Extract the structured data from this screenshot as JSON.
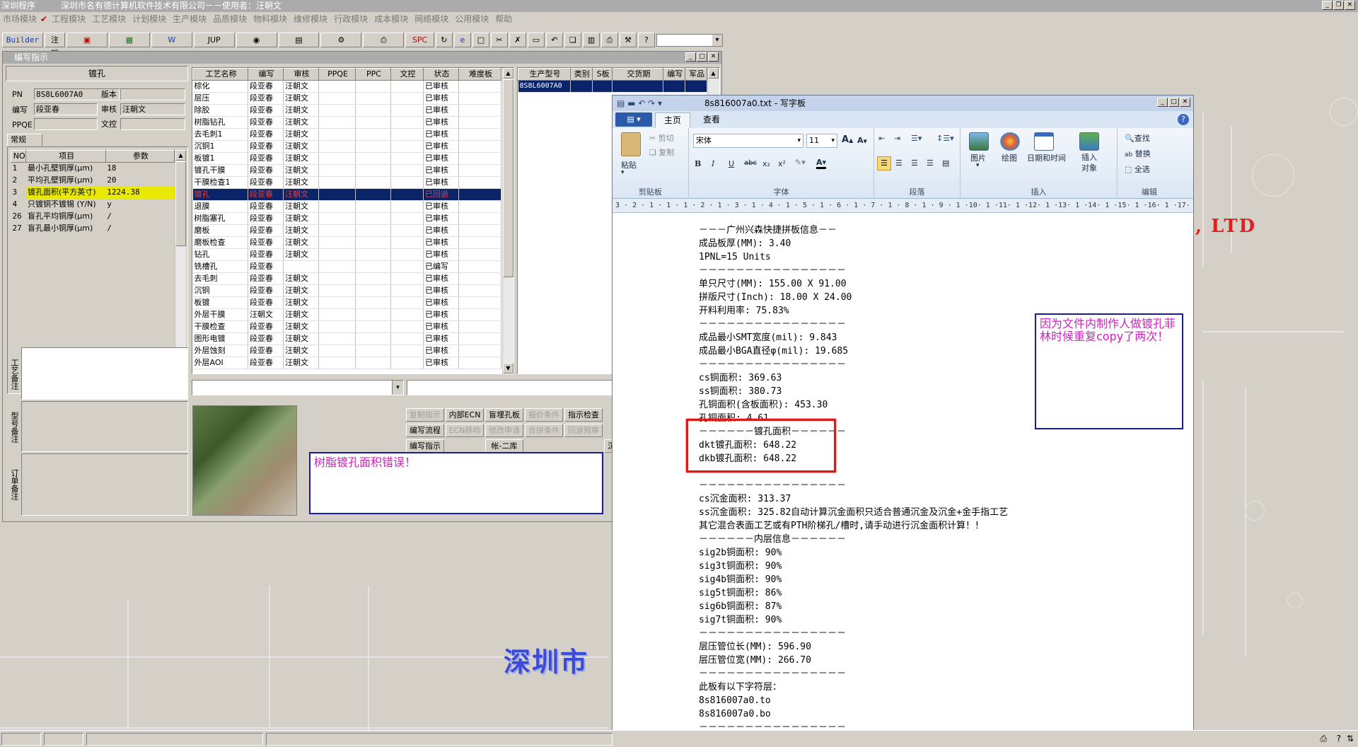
{
  "app": {
    "title": "深圳程序",
    "company": "深圳市名有德计算机软件技术有限公司－－使用者：汪朝文"
  },
  "menu": [
    "市场模块",
    "工程模块",
    "工艺模块",
    "计划模块",
    "生产模块",
    "品质模块",
    "物料模块",
    "维修模块",
    "行政模块",
    "成本模块",
    "网络模块",
    "公用模块",
    "帮助"
  ],
  "toolbar": {
    "builder": "Builder",
    "logout": "注销",
    "jup": "JUP",
    "spc": "SPC"
  },
  "editwin": {
    "title": "编写指示",
    "section": "镀孔",
    "pn_label": "PN",
    "pn_value": "8S8L6007A0",
    "version_label": "版本",
    "writer_label": "编写",
    "writer_value": "段亚春",
    "reviewer_label": "审核",
    "reviewer_value": "汪朝文",
    "ppqe_label": "PPQE",
    "doc_label": "文控",
    "tab_general": "常规",
    "param_headers": [
      "NO",
      "项目",
      "参数"
    ],
    "params": [
      {
        "no": "1",
        "item": "最小孔壁铜厚(μm)",
        "value": "18"
      },
      {
        "no": "2",
        "item": "平均孔壁铜厚(μm)",
        "value": "20"
      },
      {
        "no": "3",
        "item": "镀孔面积(平方英寸)",
        "value": "1224.38"
      },
      {
        "no": "4",
        "item": "只镀铜不镀锡 (Y/N)",
        "value": "y"
      },
      {
        "no": "26",
        "item": "盲孔平均铜厚(μm)",
        "value": "/"
      },
      {
        "no": "27",
        "item": "盲孔最小铜厚(μm)",
        "value": "/"
      }
    ],
    "side_labels": [
      "工艺备注",
      "型号备注",
      "订单备注"
    ],
    "process_headers": [
      "工艺名称",
      "编写",
      "审核",
      "PPQE",
      "PPC",
      "文控",
      "状态",
      "难度板"
    ],
    "processes": [
      [
        "棕化",
        "段亚春",
        "汪朝文",
        "",
        "",
        "",
        "已审核",
        ""
      ],
      [
        "层压",
        "段亚春",
        "汪朝文",
        "",
        "",
        "",
        "已审核",
        ""
      ],
      [
        "除胶",
        "段亚春",
        "汪朝文",
        "",
        "",
        "",
        "已审核",
        ""
      ],
      [
        "树脂钻孔",
        "段亚春",
        "汪朝文",
        "",
        "",
        "",
        "已审核",
        ""
      ],
      [
        "去毛刺1",
        "段亚春",
        "汪朝文",
        "",
        "",
        "",
        "已审核",
        ""
      ],
      [
        "沉铜1",
        "段亚春",
        "汪朝文",
        "",
        "",
        "",
        "已审核",
        ""
      ],
      [
        "板镀1",
        "段亚春",
        "汪朝文",
        "",
        "",
        "",
        "已审核",
        ""
      ],
      [
        "镀孔干膜",
        "段亚春",
        "汪朝文",
        "",
        "",
        "",
        "已审核",
        ""
      ],
      [
        "干膜检查1",
        "段亚春",
        "汪朝文",
        "",
        "",
        "",
        "已审核",
        ""
      ],
      [
        "镀孔",
        "段亚春",
        "汪朝文",
        "",
        "",
        "",
        "已回退",
        ""
      ],
      [
        "退膜",
        "段亚春",
        "汪朝文",
        "",
        "",
        "",
        "已审核",
        ""
      ],
      [
        "树脂塞孔",
        "段亚春",
        "汪朝文",
        "",
        "",
        "",
        "已审核",
        ""
      ],
      [
        "磨板",
        "段亚春",
        "汪朝文",
        "",
        "",
        "",
        "已审核",
        ""
      ],
      [
        "磨板检查",
        "段亚春",
        "汪朝文",
        "",
        "",
        "",
        "已审核",
        ""
      ],
      [
        "钻孔",
        "段亚春",
        "汪朝文",
        "",
        "",
        "",
        "已审核",
        ""
      ],
      [
        "铣槽孔",
        "段亚春",
        "",
        "",
        "",
        "",
        "已编写",
        ""
      ],
      [
        "去毛刺",
        "段亚春",
        "汪朝文",
        "",
        "",
        "",
        "已审核",
        ""
      ],
      [
        "沉铜",
        "段亚春",
        "汪朝文",
        "",
        "",
        "",
        "已审核",
        ""
      ],
      [
        "板镀",
        "段亚春",
        "汪朝文",
        "",
        "",
        "",
        "已审核",
        ""
      ],
      [
        "外层干膜",
        "汪朝文",
        "汪朝文",
        "",
        "",
        "",
        "已审核",
        ""
      ],
      [
        "干膜检查",
        "段亚春",
        "汪朝文",
        "",
        "",
        "",
        "已审核",
        ""
      ],
      [
        "图形电镀",
        "段亚春",
        "汪朝文",
        "",
        "",
        "",
        "已审核",
        ""
      ],
      [
        "外层蚀刻",
        "段亚春",
        "汪朝文",
        "",
        "",
        "",
        "已审核",
        ""
      ],
      [
        "外层AOI",
        "段亚春",
        "汪朝文",
        "",
        "",
        "",
        "已审核",
        ""
      ]
    ],
    "model_headers": [
      "生产型号",
      "类别",
      "S板",
      "交货期",
      "编写",
      "军品"
    ],
    "model_rows": [
      [
        "8S8L6007A0",
        "",
        "",
        "",
        "",
        ""
      ]
    ],
    "buttons_row1": [
      "复制指示",
      "内部ECN",
      "盲埋孔板",
      "报价条件",
      "指示检查"
    ],
    "buttons_row2": [
      "编写流程",
      "ECN移响",
      "修改申请",
      "合拼条件",
      "回退预审"
    ],
    "buttons_row3": [
      "编写指示",
      "",
      "帐-二库",
      "",
      "",
      "沉金估算"
    ],
    "buttons_disabled": [
      true,
      false,
      false,
      true,
      false
    ]
  },
  "annotations": {
    "left_note": "树脂镀孔面积错误！",
    "right_note": "因为文件内制作人做镀孔菲林时候重复copy了两次！"
  },
  "background_text": {
    "ltd": ", LTD",
    "city": "深圳市"
  },
  "wordpad": {
    "title": "8s816007a0.txt - 写字板",
    "tabs": [
      "主页",
      "查看"
    ],
    "clipboard": {
      "paste": "粘贴",
      "cut": "剪切",
      "copy": "复制",
      "group": "剪贴板"
    },
    "font": {
      "name": "宋体",
      "size": "11",
      "group": "字体"
    },
    "paragraph_group": "段落",
    "insert": {
      "picture": "图片",
      "paint": "绘图",
      "datetime": "日期和时间",
      "object": "插入对象",
      "group": "插入"
    },
    "edit": {
      "find": "查找",
      "replace": "替换",
      "selectall": "全选",
      "group": "编辑"
    },
    "ruler": "3 · 2 · 1 · 1 · 1 · 2 · 1 · 3 · 1 · 4 · 1 · 5 · 1 · 6 · 1 · 7 · 1 · 8 · 1 · 9 · 1 ·10· 1 ·11· 1 ·12· 1 ·13· 1 ·14· 1 ·15· 1 ·16· 1 ·17· 1 ·18·",
    "lines": [
      "－－－广州兴森快捷拼板信息－－",
      "成品板厚(MM): 3.40",
      "1PNL=15 Units",
      "－－－－－－－－－－－－－－－－",
      "单只尺寸(MM): 155.00 X 91.00",
      "拼版尺寸(Inch): 18.00 X 24.00",
      "开料利用率: 75.83%",
      "－－－－－－－－－－－－－－－－",
      "成品最小SMT宽度(mil): 9.843",
      "成品最小BGA直径φ(mil): 19.685",
      "－－－－－－－－－－－－－－－－",
      "cs铜面积: 369.63",
      "ss铜面积: 380.73",
      "孔铜面积(含板面积): 453.30",
      "孔铜面积: 4.61",
      "－－－－－－镀孔面积－－－－－－",
      "dkt镀孔面积: 648.22",
      "dkb镀孔面积: 648.22",
      "",
      "－－－－－－－－－－－－－－－－",
      "cs沉金面积: 313.37",
      "ss沉金面积: 325.82自动计算沉金面积只适合普通沉金及沉金+金手指工艺",
      "其它混合表面工艺或有PTH阶梯孔/槽时,请手动进行沉金面积计算！！",
      "－－－－－－内层信息－－－－－－",
      "sig2b铜面积: 90%",
      "sig3t铜面积: 90%",
      "sig4b铜面积: 90%",
      "sig5t铜面积: 86%",
      "sig6b铜面积: 87%",
      "sig7t铜面积: 90%",
      "－－－－－－－－－－－－－－－－",
      "层压管位长(MM): 596.90",
      "层压管位宽(MM): 266.70",
      "－－－－－－－－－－－－－－－－",
      "此板有以下字符层：",
      "8s816007a0.to",
      "8s816007a0.bo",
      "－－－－－－－－－－－－－－－－"
    ]
  },
  "colors": {
    "highlight_yellow": "#e8e800",
    "selection_navy": "#0a246a",
    "annotation_border": "#1a1aa8",
    "annotation_text": "#d020c0",
    "red_box": "#e01818"
  }
}
